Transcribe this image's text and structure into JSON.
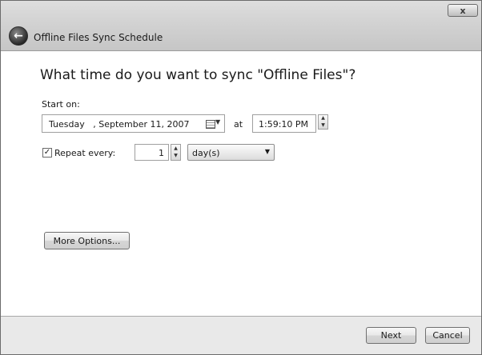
{
  "window": {
    "title": "Offline Files Sync Schedule",
    "close_glyph": "x",
    "back_glyph": "←"
  },
  "main": {
    "heading": "What time do you want to sync \"Offline Files\"?",
    "start_on_label": "Start on:",
    "date_value": "Tuesday   , September 11, 2007",
    "at_label": "at",
    "time_value": "1:59:10 PM",
    "repeat": {
      "checked": true,
      "check_glyph": "✓",
      "label": "Repeat every:",
      "value": "1",
      "unit_selected": "day(s)"
    },
    "more_options_label": "More Options..."
  },
  "footer": {
    "next_label": "Next",
    "cancel_label": "Cancel"
  },
  "icons": {
    "spin_up": "▲",
    "spin_down": "▼",
    "dropdown_arrow": "▼"
  }
}
